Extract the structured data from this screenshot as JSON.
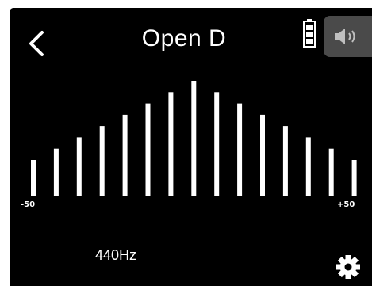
{
  "header": {
    "title": "Open D",
    "back_icon": "chevron-left-icon",
    "battery_icon": "battery-full-icon",
    "speaker_icon": "speaker-icon"
  },
  "meter": {
    "scale_min_label": "-50",
    "scale_max_label": "+50",
    "bar_count": 15
  },
  "footer": {
    "calibration_label": "440Hz",
    "settings_icon": "gear-icon"
  },
  "colors": {
    "screen_background": "#000000",
    "foreground": "#ffffff",
    "speaker_button_background": "#4a4a4a"
  }
}
